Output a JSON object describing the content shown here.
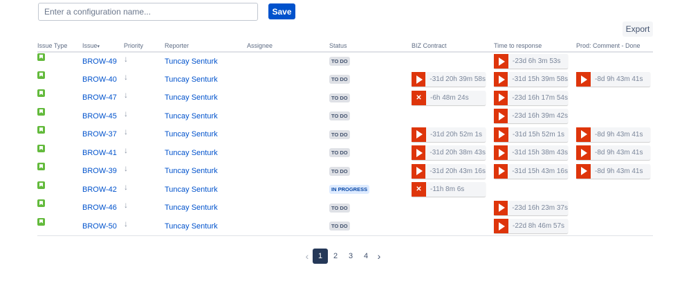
{
  "toolbar": {
    "config_placeholder": "Enter a configuration name...",
    "save_label": "Save",
    "export_label": "Export"
  },
  "columns": [
    "Issue Type",
    "Issue",
    "Priority",
    "Reporter",
    "Assignee",
    "Status",
    "BIZ Contract",
    "Time to response",
    "Prod: Comment - Done"
  ],
  "sort_indicator": "▾",
  "colors": {
    "accent": "#0052cc",
    "timer": "#de350b",
    "story": "#63ba3c"
  },
  "rows": [
    {
      "key": "BROW-49",
      "reporter": "Tuncay Senturk",
      "assignee": "",
      "status": "TO DO",
      "biz": null,
      "ttr": {
        "icon": "play",
        "text": "-23d 6h 3m 53s"
      },
      "prod": null
    },
    {
      "key": "BROW-40",
      "reporter": "Tuncay Senturk",
      "assignee": "",
      "status": "TO DO",
      "biz": {
        "icon": "play",
        "text": "-31d 20h 39m 58s"
      },
      "ttr": {
        "icon": "play",
        "text": "-31d 15h 39m 58s"
      },
      "prod": {
        "icon": "play",
        "text": "-8d 9h 43m 41s"
      }
    },
    {
      "key": "BROW-47",
      "reporter": "Tuncay Senturk",
      "assignee": "",
      "status": "TO DO",
      "biz": {
        "icon": "x",
        "text": "-6h 48m 24s"
      },
      "ttr": {
        "icon": "play",
        "text": "-23d 16h 17m 54s"
      },
      "prod": null
    },
    {
      "key": "BROW-45",
      "reporter": "Tuncay Senturk",
      "assignee": "",
      "status": "TO DO",
      "biz": null,
      "ttr": {
        "icon": "play",
        "text": "-23d 16h 39m 42s"
      },
      "prod": null
    },
    {
      "key": "BROW-37",
      "reporter": "Tuncay Senturk",
      "assignee": "",
      "status": "TO DO",
      "biz": {
        "icon": "play",
        "text": "-31d 20h 52m 1s"
      },
      "ttr": {
        "icon": "play",
        "text": "-31d 15h 52m 1s"
      },
      "prod": {
        "icon": "play",
        "text": "-8d 9h 43m 41s"
      }
    },
    {
      "key": "BROW-41",
      "reporter": "Tuncay Senturk",
      "assignee": "",
      "status": "TO DO",
      "biz": {
        "icon": "play",
        "text": "-31d 20h 38m 43s"
      },
      "ttr": {
        "icon": "play",
        "text": "-31d 15h 38m 43s"
      },
      "prod": {
        "icon": "play",
        "text": "-8d 9h 43m 41s"
      }
    },
    {
      "key": "BROW-39",
      "reporter": "Tuncay Senturk",
      "assignee": "",
      "status": "TO DO",
      "biz": {
        "icon": "play",
        "text": "-31d 20h 43m 16s"
      },
      "ttr": {
        "icon": "play",
        "text": "-31d 15h 43m 16s"
      },
      "prod": {
        "icon": "play",
        "text": "-8d 9h 43m 41s"
      }
    },
    {
      "key": "BROW-42",
      "reporter": "Tuncay Senturk",
      "assignee": "",
      "status": "IN PROGRESS",
      "biz": {
        "icon": "x",
        "text": "-11h 8m 6s"
      },
      "ttr": null,
      "prod": null
    },
    {
      "key": "BROW-46",
      "reporter": "Tuncay Senturk",
      "assignee": "",
      "status": "TO DO",
      "biz": null,
      "ttr": {
        "icon": "play",
        "text": "-23d 16h 23m 37s"
      },
      "prod": null
    },
    {
      "key": "BROW-50",
      "reporter": "Tuncay Senturk",
      "assignee": "",
      "status": "TO DO",
      "biz": null,
      "ttr": {
        "icon": "play",
        "text": "-22d 8h 46m 57s"
      },
      "prod": null
    }
  ],
  "pagination": {
    "pages": [
      "1",
      "2",
      "3",
      "4"
    ],
    "current": "1"
  }
}
